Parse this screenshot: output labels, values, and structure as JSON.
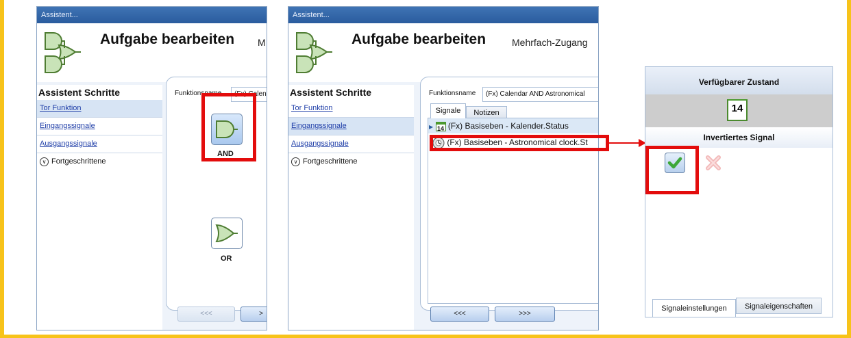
{
  "window_left": {
    "title": "Assistent...",
    "header_title": "Aufgabe bearbeiten",
    "header_sub": "M",
    "steps_title": "Assistent Schritte",
    "steps": [
      "Tor Funktion",
      "Eingangssignale",
      "Ausgangssignale"
    ],
    "advanced": "Fortgeschrittene",
    "function_label": "Funktionsname",
    "function_value": "(Fx) Calen",
    "gate_and_label": "AND",
    "gate_or_label": "OR",
    "back_button": "<<<",
    "next_button": ">"
  },
  "window_mid": {
    "title": "Assistent...",
    "header_title": "Aufgabe bearbeiten",
    "header_sub": "Mehrfach-Zugang",
    "steps_title": "Assistent Schritte",
    "steps": [
      "Tor Funktion",
      "Eingangssignale",
      "Ausgangssignale"
    ],
    "advanced": "Fortgeschrittene",
    "function_label": "Funktionsname",
    "function_value": "(Fx) Calendar AND Astronomical",
    "tabs": [
      "Signale",
      "Notizen"
    ],
    "signals": [
      {
        "icon": "calendar-icon",
        "icon_text": "14",
        "text": "(Fx) Basiseben - Kalender.Status"
      },
      {
        "icon": "clock-icon",
        "text": "(Fx) Basiseben - Astronomical clock.St"
      }
    ],
    "back_button": "<<<",
    "next_button": ">>>"
  },
  "panel": {
    "header": "Verfügbarer Zustand",
    "state_icon_text": "14",
    "sub_header": "Invertiertes Signal",
    "tabs": [
      "Signaleinstellungen",
      "Signaleigenschaften"
    ]
  },
  "colors": {
    "frame": "#f7c31a",
    "highlight": "#e30c0c",
    "titlebar": "#2a5c9e",
    "check": "#3ea83a"
  }
}
